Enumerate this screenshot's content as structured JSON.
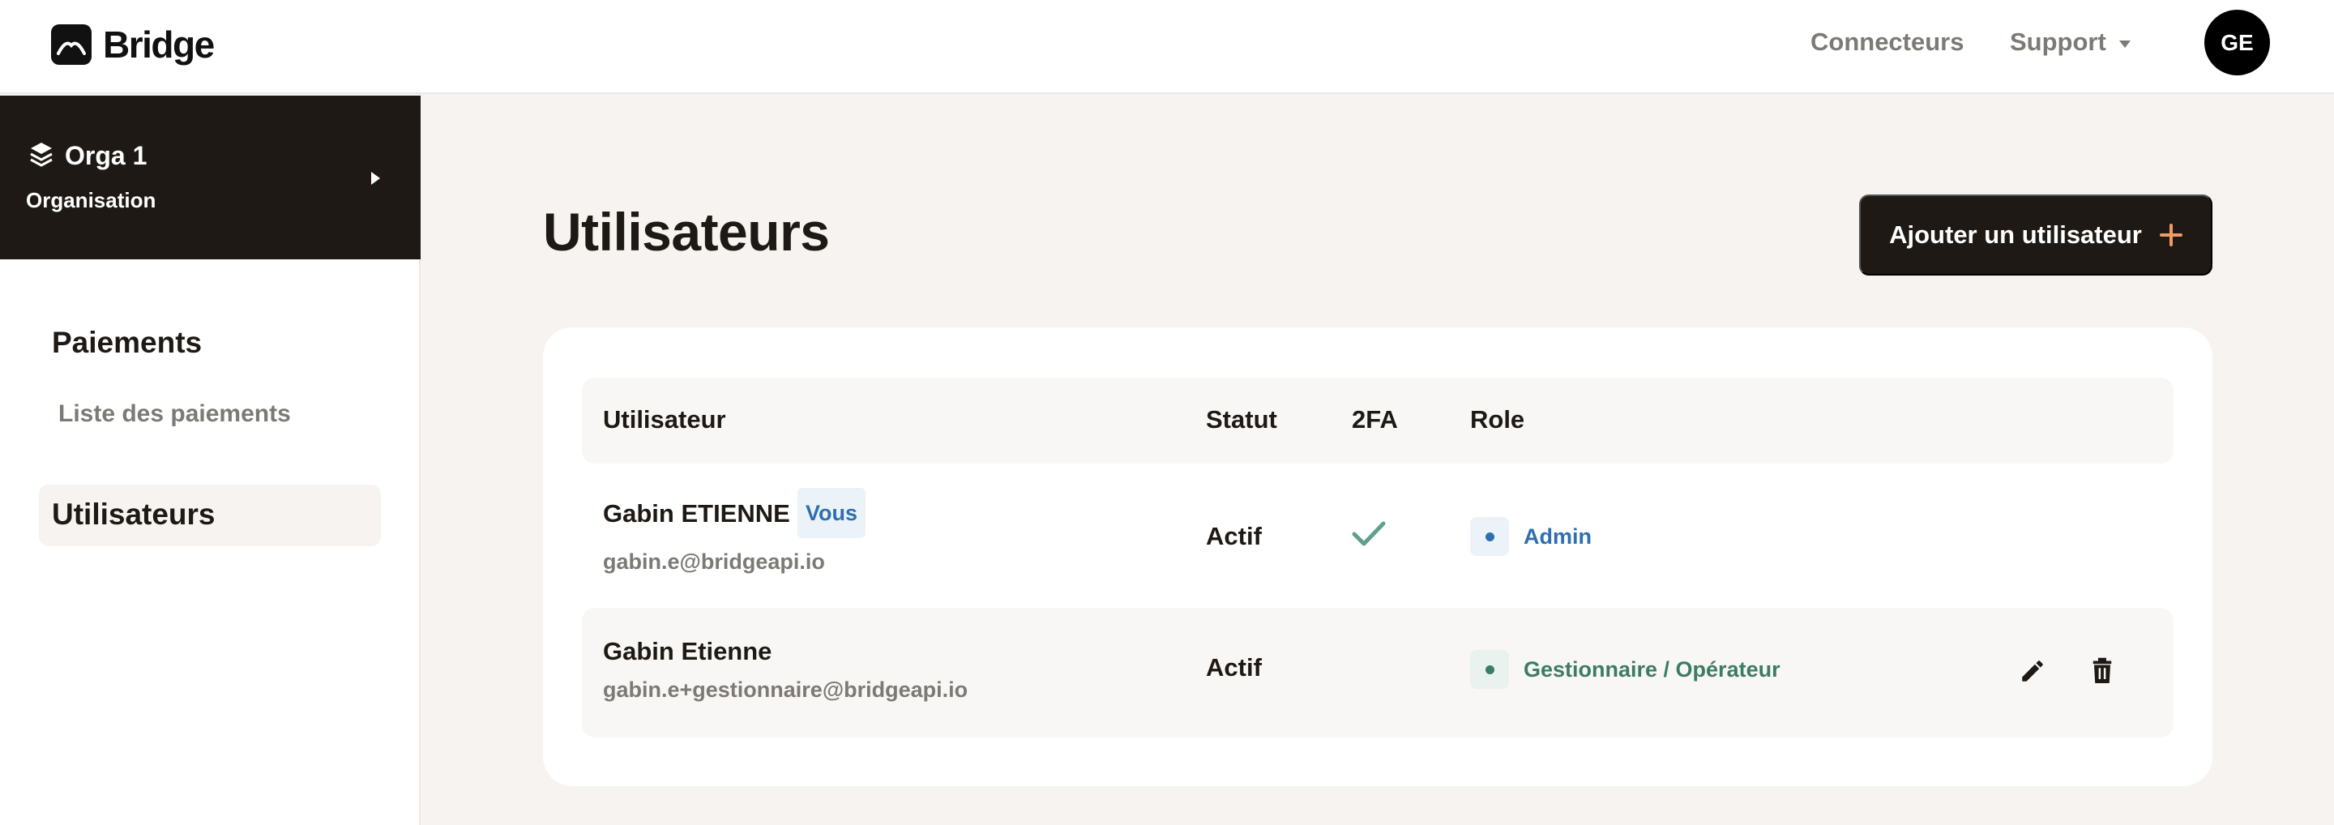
{
  "header": {
    "brand": "Bridge",
    "nav": {
      "connectors": "Connecteurs",
      "support": "Support"
    },
    "avatar_initials": "GE"
  },
  "sidebar": {
    "org": {
      "name": "Orga 1",
      "subtitle": "Organisation"
    },
    "sections": [
      {
        "title": "Paiements",
        "items": [
          "Liste des paiements"
        ]
      }
    ],
    "active_item": "Utilisateurs"
  },
  "main": {
    "title": "Utilisateurs",
    "add_button_label": "Ajouter un utilisateur",
    "table": {
      "columns": [
        "Utilisateur",
        "Statut",
        "2FA",
        "Role"
      ],
      "rows": [
        {
          "name": "Gabin ETIENNE",
          "badge": "Vous",
          "email": "gabin.e@bridgeapi.io",
          "status": "Actif",
          "twofa": true,
          "role": "Admin"
        },
        {
          "name": "Gabin Etienne",
          "badge": "",
          "email": "gabin.e+gestionnaire@bridgeapi.io",
          "status": "Actif",
          "twofa": false,
          "role": "Gestionnaire / Opérateur"
        }
      ]
    }
  },
  "icons": {
    "logo": "bridge-logo-icon",
    "support_caret": "chevron-down-icon",
    "org_icon": "layers-icon",
    "org_expand": "caret-right-icon",
    "add": "plus-icon",
    "twofa_enabled": "check-icon",
    "role_marker": "dot-icon",
    "edit": "pencil-icon",
    "delete": "trash-icon"
  },
  "colors": {
    "primary_dark": "#1e1914",
    "background": "#f6f3f0",
    "accent_orange": "#f09a6a",
    "admin_blue": "#2e6fb0",
    "manager_green": "#3b7d63",
    "check_green": "#5fa08d",
    "muted_text": "#7d7975"
  }
}
